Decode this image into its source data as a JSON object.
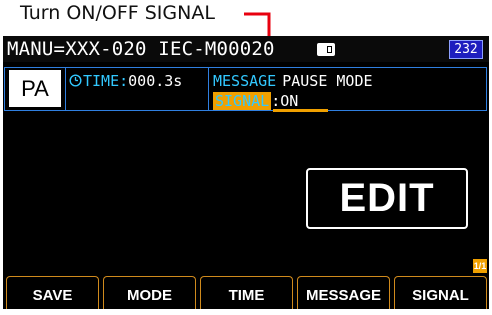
{
  "annotation": {
    "text": "Turn ON/OFF SIGNAL",
    "arrow_color": "#e8000f"
  },
  "titlebar": {
    "text": "MANU=XXX-020  IEC-M00020",
    "interface_badge": "232"
  },
  "status": {
    "mode_badge": "PA",
    "time_label": "TIME:",
    "time_value": "000.3s",
    "message_label": "MESSAGE",
    "message_value": "PAUSE MODE",
    "signal_label": "SIGNAL",
    "signal_value": ":ON"
  },
  "main": {
    "edit_label": "EDIT",
    "page_indicator": "1/1"
  },
  "softkeys": [
    "SAVE",
    "MODE",
    "TIME",
    "MESSAGE",
    "SIGNAL"
  ],
  "colors": {
    "accent_orange": "#f0a000",
    "label_cyan": "#32c8ff",
    "frame_blue": "#2f7fe0",
    "badge_blue": "#1e1ebf"
  }
}
